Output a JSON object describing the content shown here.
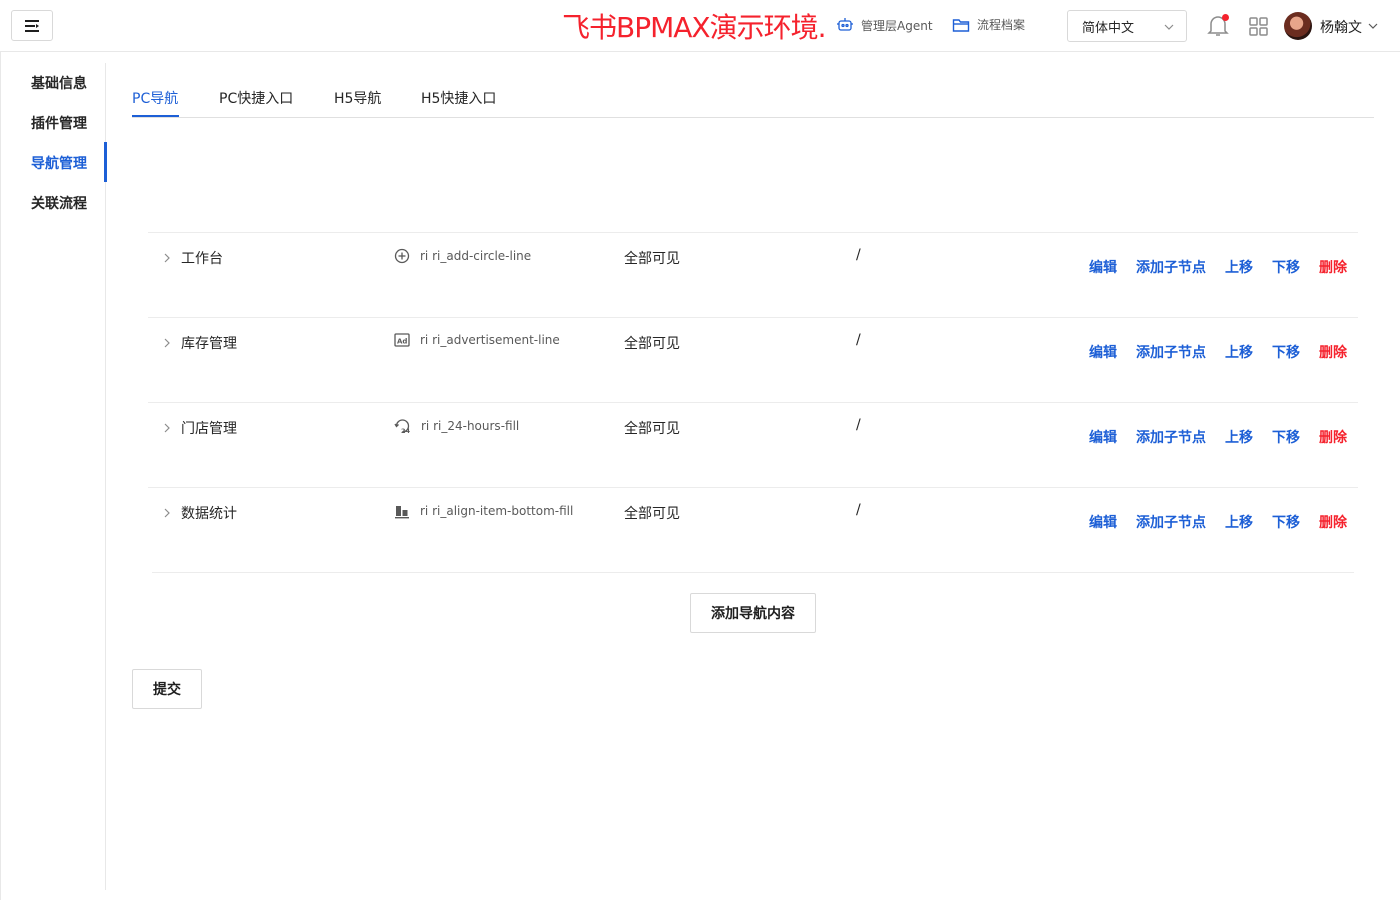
{
  "header": {
    "watermark": "飞书BPMAX演示环境.",
    "links": [
      {
        "label": "管理层Agent",
        "icon": "robot-icon"
      },
      {
        "label": "流程档案",
        "icon": "folder-icon"
      }
    ],
    "language": "简体中文",
    "user_name": "杨翰文",
    "notification_dot": true
  },
  "sidebar": {
    "items": [
      {
        "label": "基础信息",
        "active": false
      },
      {
        "label": "插件管理",
        "active": false
      },
      {
        "label": "导航管理",
        "active": true
      },
      {
        "label": "关联流程",
        "active": false
      }
    ]
  },
  "tabs": [
    {
      "label": "PC导航",
      "active": true
    },
    {
      "label": "PC快捷入口",
      "active": false
    },
    {
      "label": "H5导航",
      "active": false
    },
    {
      "label": "H5快捷入口",
      "active": false
    }
  ],
  "nav_rows": [
    {
      "name": "工作台",
      "icon_text": "ri  ri_add-circle-line",
      "icon": "add-circle-icon",
      "visibility": "全部可见",
      "path": "/"
    },
    {
      "name": "库存管理",
      "icon_text": "ri  ri_advertisement-line",
      "icon": "advertisement-icon",
      "visibility": "全部可见",
      "path": "/"
    },
    {
      "name": "门店管理",
      "icon_text": "ri  ri_24-hours-fill",
      "icon": "24-hours-icon",
      "visibility": "全部可见",
      "path": "/"
    },
    {
      "name": "数据统计",
      "icon_text": "ri  ri_align-item-bottom-fill",
      "icon": "align-item-bottom-icon",
      "visibility": "全部可见",
      "path": "/"
    }
  ],
  "row_actions": {
    "edit": "编辑",
    "add_child": "添加子节点",
    "move_up": "上移",
    "move_down": "下移",
    "delete": "删除"
  },
  "buttons": {
    "add_nav": "添加导航内容",
    "submit": "提交"
  },
  "colors": {
    "accent": "#1d5fd6",
    "danger": "#f5222d",
    "watermark": "#f5222d"
  }
}
